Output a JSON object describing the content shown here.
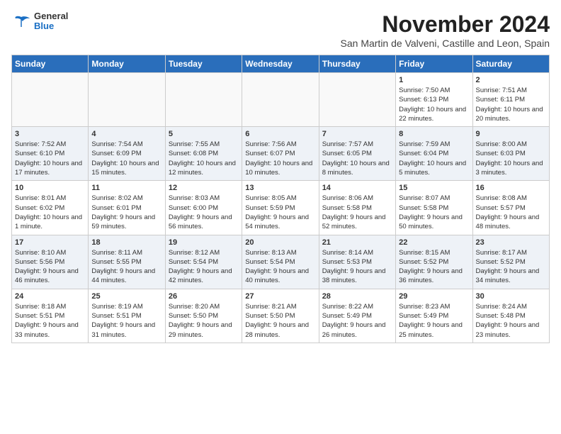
{
  "logo": {
    "general": "General",
    "blue": "Blue"
  },
  "header": {
    "title": "November 2024",
    "subtitle": "San Martin de Valveni, Castille and Leon, Spain"
  },
  "weekdays": [
    "Sunday",
    "Monday",
    "Tuesday",
    "Wednesday",
    "Thursday",
    "Friday",
    "Saturday"
  ],
  "weeks": [
    [
      {
        "day": "",
        "info": ""
      },
      {
        "day": "",
        "info": ""
      },
      {
        "day": "",
        "info": ""
      },
      {
        "day": "",
        "info": ""
      },
      {
        "day": "",
        "info": ""
      },
      {
        "day": "1",
        "info": "Sunrise: 7:50 AM\nSunset: 6:13 PM\nDaylight: 10 hours and 22 minutes."
      },
      {
        "day": "2",
        "info": "Sunrise: 7:51 AM\nSunset: 6:11 PM\nDaylight: 10 hours and 20 minutes."
      }
    ],
    [
      {
        "day": "3",
        "info": "Sunrise: 7:52 AM\nSunset: 6:10 PM\nDaylight: 10 hours and 17 minutes."
      },
      {
        "day": "4",
        "info": "Sunrise: 7:54 AM\nSunset: 6:09 PM\nDaylight: 10 hours and 15 minutes."
      },
      {
        "day": "5",
        "info": "Sunrise: 7:55 AM\nSunset: 6:08 PM\nDaylight: 10 hours and 12 minutes."
      },
      {
        "day": "6",
        "info": "Sunrise: 7:56 AM\nSunset: 6:07 PM\nDaylight: 10 hours and 10 minutes."
      },
      {
        "day": "7",
        "info": "Sunrise: 7:57 AM\nSunset: 6:05 PM\nDaylight: 10 hours and 8 minutes."
      },
      {
        "day": "8",
        "info": "Sunrise: 7:59 AM\nSunset: 6:04 PM\nDaylight: 10 hours and 5 minutes."
      },
      {
        "day": "9",
        "info": "Sunrise: 8:00 AM\nSunset: 6:03 PM\nDaylight: 10 hours and 3 minutes."
      }
    ],
    [
      {
        "day": "10",
        "info": "Sunrise: 8:01 AM\nSunset: 6:02 PM\nDaylight: 10 hours and 1 minute."
      },
      {
        "day": "11",
        "info": "Sunrise: 8:02 AM\nSunset: 6:01 PM\nDaylight: 9 hours and 59 minutes."
      },
      {
        "day": "12",
        "info": "Sunrise: 8:03 AM\nSunset: 6:00 PM\nDaylight: 9 hours and 56 minutes."
      },
      {
        "day": "13",
        "info": "Sunrise: 8:05 AM\nSunset: 5:59 PM\nDaylight: 9 hours and 54 minutes."
      },
      {
        "day": "14",
        "info": "Sunrise: 8:06 AM\nSunset: 5:58 PM\nDaylight: 9 hours and 52 minutes."
      },
      {
        "day": "15",
        "info": "Sunrise: 8:07 AM\nSunset: 5:58 PM\nDaylight: 9 hours and 50 minutes."
      },
      {
        "day": "16",
        "info": "Sunrise: 8:08 AM\nSunset: 5:57 PM\nDaylight: 9 hours and 48 minutes."
      }
    ],
    [
      {
        "day": "17",
        "info": "Sunrise: 8:10 AM\nSunset: 5:56 PM\nDaylight: 9 hours and 46 minutes."
      },
      {
        "day": "18",
        "info": "Sunrise: 8:11 AM\nSunset: 5:55 PM\nDaylight: 9 hours and 44 minutes."
      },
      {
        "day": "19",
        "info": "Sunrise: 8:12 AM\nSunset: 5:54 PM\nDaylight: 9 hours and 42 minutes."
      },
      {
        "day": "20",
        "info": "Sunrise: 8:13 AM\nSunset: 5:54 PM\nDaylight: 9 hours and 40 minutes."
      },
      {
        "day": "21",
        "info": "Sunrise: 8:14 AM\nSunset: 5:53 PM\nDaylight: 9 hours and 38 minutes."
      },
      {
        "day": "22",
        "info": "Sunrise: 8:15 AM\nSunset: 5:52 PM\nDaylight: 9 hours and 36 minutes."
      },
      {
        "day": "23",
        "info": "Sunrise: 8:17 AM\nSunset: 5:52 PM\nDaylight: 9 hours and 34 minutes."
      }
    ],
    [
      {
        "day": "24",
        "info": "Sunrise: 8:18 AM\nSunset: 5:51 PM\nDaylight: 9 hours and 33 minutes."
      },
      {
        "day": "25",
        "info": "Sunrise: 8:19 AM\nSunset: 5:51 PM\nDaylight: 9 hours and 31 minutes."
      },
      {
        "day": "26",
        "info": "Sunrise: 8:20 AM\nSunset: 5:50 PM\nDaylight: 9 hours and 29 minutes."
      },
      {
        "day": "27",
        "info": "Sunrise: 8:21 AM\nSunset: 5:50 PM\nDaylight: 9 hours and 28 minutes."
      },
      {
        "day": "28",
        "info": "Sunrise: 8:22 AM\nSunset: 5:49 PM\nDaylight: 9 hours and 26 minutes."
      },
      {
        "day": "29",
        "info": "Sunrise: 8:23 AM\nSunset: 5:49 PM\nDaylight: 9 hours and 25 minutes."
      },
      {
        "day": "30",
        "info": "Sunrise: 8:24 AM\nSunset: 5:48 PM\nDaylight: 9 hours and 23 minutes."
      }
    ]
  ]
}
